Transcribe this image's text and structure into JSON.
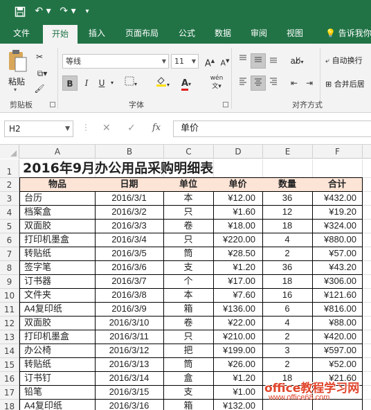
{
  "quick_access": {
    "save_icon": "save-icon",
    "undo_icon": "undo-icon",
    "redo_icon": "redo-icon",
    "customize_icon": "customize-qat-icon"
  },
  "tabs": [
    "文件",
    "开始",
    "插入",
    "页面布局",
    "公式",
    "数据",
    "审阅",
    "视图",
    "告诉我你"
  ],
  "active_tab": "开始",
  "ribbon": {
    "clipboard": {
      "paste_label": "粘贴",
      "group_label": "剪贴板"
    },
    "font": {
      "family": "等线",
      "size": "11",
      "group_label": "字体",
      "bold": "B",
      "italic": "I",
      "underline": "U",
      "phonetic": "wén"
    },
    "alignment": {
      "wrap_label": "自动换行",
      "merge_label": "合并后居",
      "group_label": "对齐方式"
    }
  },
  "formula_bar": {
    "name_box": "H2",
    "fx_label": "fx",
    "content": "单价"
  },
  "columns": [
    "A",
    "B",
    "C",
    "D",
    "E",
    "F"
  ],
  "row_numbers": [
    "1",
    "2",
    "3",
    "4",
    "5",
    "6",
    "7",
    "8",
    "9",
    "10",
    "11",
    "12",
    "13",
    "14",
    "15",
    "16",
    "17",
    "18"
  ],
  "sheet": {
    "title": "2016年9月办公用品采购明细表",
    "headers": [
      "物品",
      "日期",
      "单位",
      "单价",
      "数量",
      "合计"
    ],
    "rows": [
      [
        "台历",
        "2016/3/1",
        "本",
        "¥12.00",
        "36",
        "¥432.00"
      ],
      [
        "档案盒",
        "2016/3/2",
        "只",
        "¥1.60",
        "12",
        "¥19.20"
      ],
      [
        "双面胶",
        "2016/3/3",
        "卷",
        "¥18.00",
        "18",
        "¥324.00"
      ],
      [
        "打印机墨盒",
        "2016/3/4",
        "只",
        "¥220.00",
        "4",
        "¥880.00"
      ],
      [
        "转贴纸",
        "2016/3/5",
        "筒",
        "¥28.50",
        "2",
        "¥57.00"
      ],
      [
        "签字笔",
        "2016/3/6",
        "支",
        "¥1.20",
        "36",
        "¥43.20"
      ],
      [
        "订书器",
        "2016/3/7",
        "个",
        "¥17.00",
        "18",
        "¥306.00"
      ],
      [
        "文件夹",
        "2016/3/8",
        "本",
        "¥7.60",
        "16",
        "¥121.60"
      ],
      [
        "A4复印纸",
        "2016/3/9",
        "箱",
        "¥136.00",
        "6",
        "¥816.00"
      ],
      [
        "双面胶",
        "2016/3/10",
        "卷",
        "¥22.00",
        "4",
        "¥88.00"
      ],
      [
        "打印机墨盒",
        "2016/3/11",
        "只",
        "¥210.00",
        "2",
        "¥420.00"
      ],
      [
        "办公椅",
        "2016/3/12",
        "把",
        "¥199.00",
        "3",
        "¥597.00"
      ],
      [
        "转贴纸",
        "2016/3/13",
        "筒",
        "¥26.00",
        "2",
        "¥52.00"
      ],
      [
        "订书钉",
        "2016/3/14",
        "盒",
        "¥1.20",
        "18",
        "¥21.60"
      ],
      [
        "铅笔",
        "2016/3/15",
        "支",
        "¥1.00",
        "",
        ""
      ],
      [
        "A4复印纸",
        "2016/3/16",
        "箱",
        "¥132.00",
        "",
        ""
      ]
    ]
  },
  "watermark": {
    "line1": "office教程学习网",
    "line2": "www.office68.com"
  }
}
